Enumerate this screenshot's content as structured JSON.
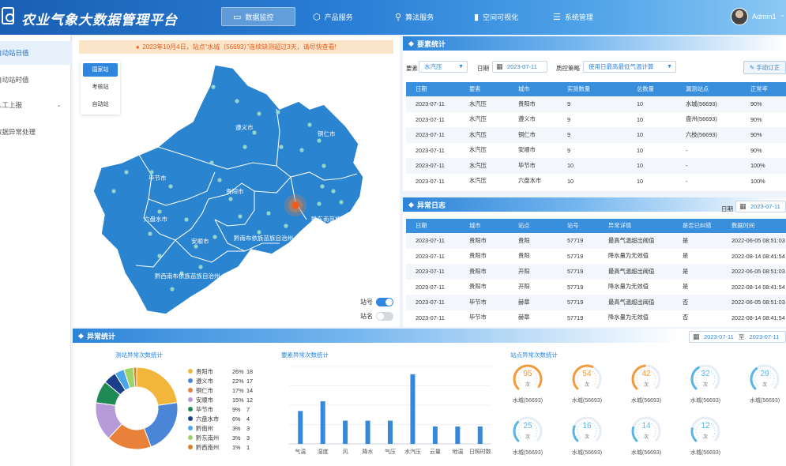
{
  "app": {
    "title": "农业气象大数据管理平台",
    "user": "Admin1"
  },
  "nav": [
    {
      "label": "数据监控",
      "icon": "monitor-icon",
      "active": true
    },
    {
      "label": "产品服务",
      "icon": "cube-icon",
      "active": false
    },
    {
      "label": "算法服务",
      "icon": "share-icon",
      "active": false
    },
    {
      "label": "空间可视化",
      "icon": "bar-chart-icon",
      "active": false
    },
    {
      "label": "系统管理",
      "icon": "sliders-icon",
      "active": false
    }
  ],
  "sidebar": {
    "items": [
      {
        "label": "自动站日值",
        "active": true
      },
      {
        "label": "自动站时值",
        "active": false
      },
      {
        "label": "人工上报",
        "active": false
      },
      {
        "label": "数据异常处理",
        "active": false
      }
    ]
  },
  "map": {
    "alert": "2023年10月4日，站点“水城（56693）”连续缺测超过3天，请尽快查看!",
    "station_types": [
      "国家站",
      "考核站",
      "自动站"
    ],
    "regions": [
      "遵义市",
      "铜仁市",
      "毕节市",
      "贵阳市",
      "六盘水市",
      "安顺市",
      "黔南布依族苗族自治州",
      "黔东南苗族侗族自治州",
      "黔西南布依族苗族自治州"
    ],
    "toggle_station_no": {
      "label": "站号",
      "on": true
    },
    "toggle_station_name": {
      "label": "站名",
      "on": false
    }
  },
  "element_stats": {
    "title": "要素统计",
    "element_label": "要素",
    "element_value": "水汽压",
    "date_label": "日期",
    "date_value": "2023-07-11",
    "qc_label": "质控策略",
    "qc_value": "使用日最高最低气温计算",
    "manual_button": "手动订正",
    "columns": [
      "日期",
      "要素",
      "城市",
      "实测数量",
      "总数量",
      "漏测站点",
      "正常率"
    ],
    "rows": [
      [
        "2023-07-11",
        "水汽压",
        "贵阳市",
        "9",
        "10",
        "水城(56693)",
        "90%"
      ],
      [
        "2023-07-11",
        "水汽压",
        "遵义市",
        "9",
        "10",
        "盘州(56693)",
        "90%"
      ],
      [
        "2023-07-11",
        "水汽压",
        "铜仁市",
        "9",
        "10",
        "六枝(56693)",
        "90%"
      ],
      [
        "2023-07-11",
        "水汽压",
        "安顺市",
        "9",
        "10",
        "-",
        "90%"
      ],
      [
        "2023-07-11",
        "水汽压",
        "毕节市",
        "10",
        "10",
        "-",
        "100%"
      ],
      [
        "2023-07-11",
        "水汽压",
        "六盘水市",
        "10",
        "10",
        "-",
        "100%"
      ]
    ]
  },
  "anomaly_log": {
    "title": "异常日志",
    "date_label": "日期",
    "date_value": "2023-07-11",
    "columns": [
      "日期",
      "城市",
      "站点",
      "站号",
      "异常详情",
      "是否已纠错",
      "数据时间"
    ],
    "rows": [
      [
        "2023-07-11",
        "贵阳市",
        "贵阳",
        "57719",
        "最高气温超出阈值",
        "是",
        "2022-06-05 08:51:03"
      ],
      [
        "2023-07-11",
        "贵阳市",
        "贵阳",
        "57719",
        "降水量为无效值",
        "是",
        "2022-08-14 08:41:54"
      ],
      [
        "2023-07-11",
        "贵阳市",
        "开阳",
        "57719",
        "最高气温超出阈值",
        "是",
        "2022-06-05 08:51:03"
      ],
      [
        "2023-07-11",
        "贵阳市",
        "开阳",
        "57719",
        "降水量为无效值",
        "是",
        "2022-08-14 08:41:54"
      ],
      [
        "2023-07-11",
        "毕节市",
        "赫章",
        "57719",
        "最高气温超出阈值",
        "否",
        "2022-06-05 08:51:03"
      ],
      [
        "2023-07-11",
        "毕节市",
        "赫章",
        "57719",
        "降水量为无效值",
        "否",
        "2022-08-14 08:41:54"
      ]
    ]
  },
  "anomaly_stats": {
    "title": "异常统计",
    "date_from": "2023-07-11",
    "date_sep": "至",
    "date_to": "2023-07-11"
  },
  "chart_data": [
    {
      "type": "pie",
      "title": "测站异常次数统计",
      "categories": [
        "贵阳市",
        "遵义市",
        "铜仁市",
        "安顺市",
        "毕节市",
        "六盘水市",
        "黔南州",
        "黔东南州",
        "黔西南州"
      ],
      "percent_labels": [
        "26%",
        "22%",
        "17%",
        "15%",
        "9%",
        "6%",
        "3%",
        "3%",
        "1%"
      ],
      "values": [
        18,
        17,
        14,
        12,
        7,
        4,
        3,
        3,
        1
      ],
      "colors": [
        "#f2b63c",
        "#4b86d6",
        "#e8823a",
        "#b79bd8",
        "#1f8a55",
        "#1c3f8c",
        "#4aa7e8",
        "#9ed26b",
        "#d9822b"
      ]
    },
    {
      "type": "bar",
      "title": "要素异常次数统计",
      "categories": [
        "气温",
        "湿度",
        "风",
        "降水",
        "气压",
        "水汽压",
        "云量",
        "地温",
        "日照时数"
      ],
      "values": [
        17,
        22,
        12,
        12,
        12,
        36,
        9,
        9,
        9
      ],
      "ylim": [
        0,
        40
      ]
    },
    {
      "type": "gauge",
      "title": "站点异常次数统计",
      "items": [
        {
          "value": "95",
          "unit": "次",
          "label": "水城(56693)",
          "color": "#f29a3c"
        },
        {
          "value": "54",
          "unit": "次",
          "label": "水城(56693)",
          "color": "#f29a3c"
        },
        {
          "value": "42",
          "unit": "次",
          "label": "水城(56693)",
          "color": "#f29a3c"
        },
        {
          "value": "32",
          "unit": "次",
          "label": "水城(56693)",
          "color": "#5bb4e6"
        },
        {
          "value": "29",
          "unit": "次",
          "label": "水城(56693)",
          "color": "#5bb4e6"
        },
        {
          "value": "25",
          "unit": "次",
          "label": "水城(56693)",
          "color": "#5bb4e6"
        },
        {
          "value": "16",
          "unit": "次",
          "label": "水城(56693)",
          "color": "#5bb4e6"
        },
        {
          "value": "14",
          "unit": "次",
          "label": "水城(56693)",
          "color": "#5bb4e6"
        },
        {
          "value": "12",
          "unit": "次",
          "label": "水城(56693)",
          "color": "#5bb4e6"
        }
      ]
    }
  ]
}
